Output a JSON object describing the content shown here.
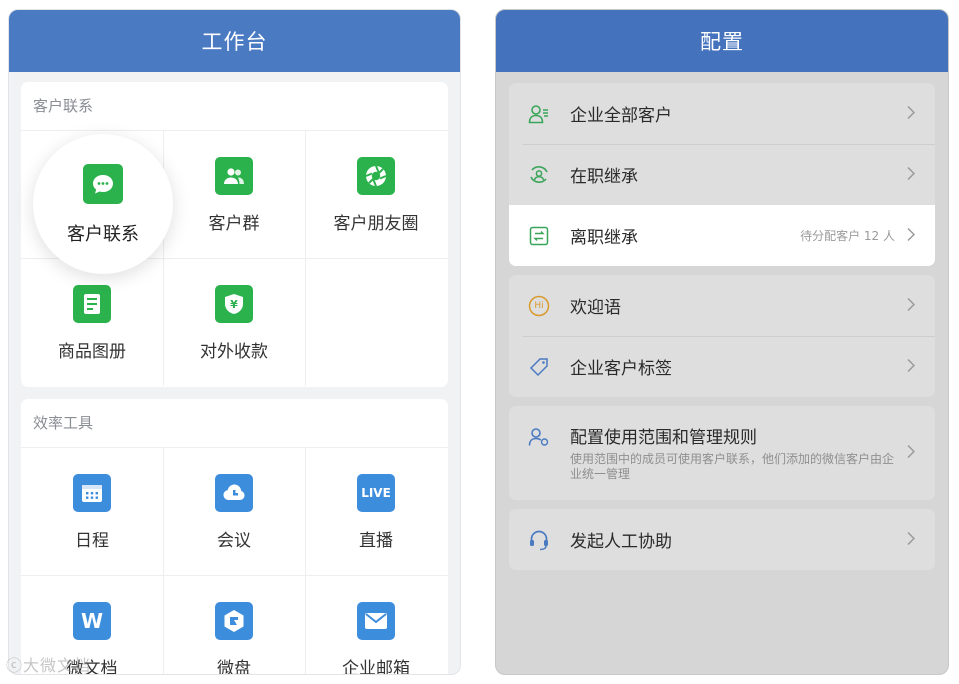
{
  "workbench": {
    "title": "工作台",
    "customer_section": {
      "title": "客户联系",
      "items": [
        {
          "label": "客户联系",
          "icon": "chat-bubble-icon"
        },
        {
          "label": "客户群",
          "icon": "group-users-icon"
        },
        {
          "label": "客户朋友圈",
          "icon": "moments-shutter-icon"
        },
        {
          "label": "商品图册",
          "icon": "catalog-icon"
        },
        {
          "label": "对外收款",
          "icon": "yen-shield-icon"
        }
      ]
    },
    "efficiency_section": {
      "title": "效率工具",
      "items": [
        {
          "label": "日程",
          "icon": "calendar-icon"
        },
        {
          "label": "会议",
          "icon": "meeting-icon"
        },
        {
          "label": "直播",
          "icon": "live-icon",
          "badge": "LIVE"
        },
        {
          "label": "微文档",
          "icon": "word-doc-icon",
          "badge": "W"
        },
        {
          "label": "微盘",
          "icon": "drive-icon"
        },
        {
          "label": "企业邮箱",
          "icon": "mail-icon"
        }
      ]
    }
  },
  "config": {
    "title": "配置",
    "groups": [
      [
        {
          "label": "企业全部客户",
          "icon": "customers-icon"
        },
        {
          "label": "在职继承",
          "icon": "transfer-icon"
        },
        {
          "label": "离职继承",
          "icon": "resign-transfer-icon",
          "hint": "待分配客户 12 人"
        }
      ],
      [
        {
          "label": "欢迎语",
          "icon": "hi-icon",
          "badge": "Hi"
        },
        {
          "label": "企业客户标签",
          "icon": "tag-icon"
        }
      ],
      [
        {
          "label": "配置使用范围和管理规则",
          "icon": "user-settings-icon",
          "sub": "使用范围中的成员可使用客户联系，他们添加的微信客户由企业统一管理"
        }
      ],
      [
        {
          "label": "发起人工协助",
          "icon": "headset-icon"
        }
      ]
    ]
  },
  "watermark": "大微文档",
  "colors": {
    "header_blue": "#4a7ac2",
    "icon_green": "#2bb24c",
    "icon_blue": "#3d8ddd",
    "config_icon_green": "#3aa55a",
    "config_icon_blue": "#4a7ac2",
    "config_icon_orange": "#d99a2b"
  }
}
